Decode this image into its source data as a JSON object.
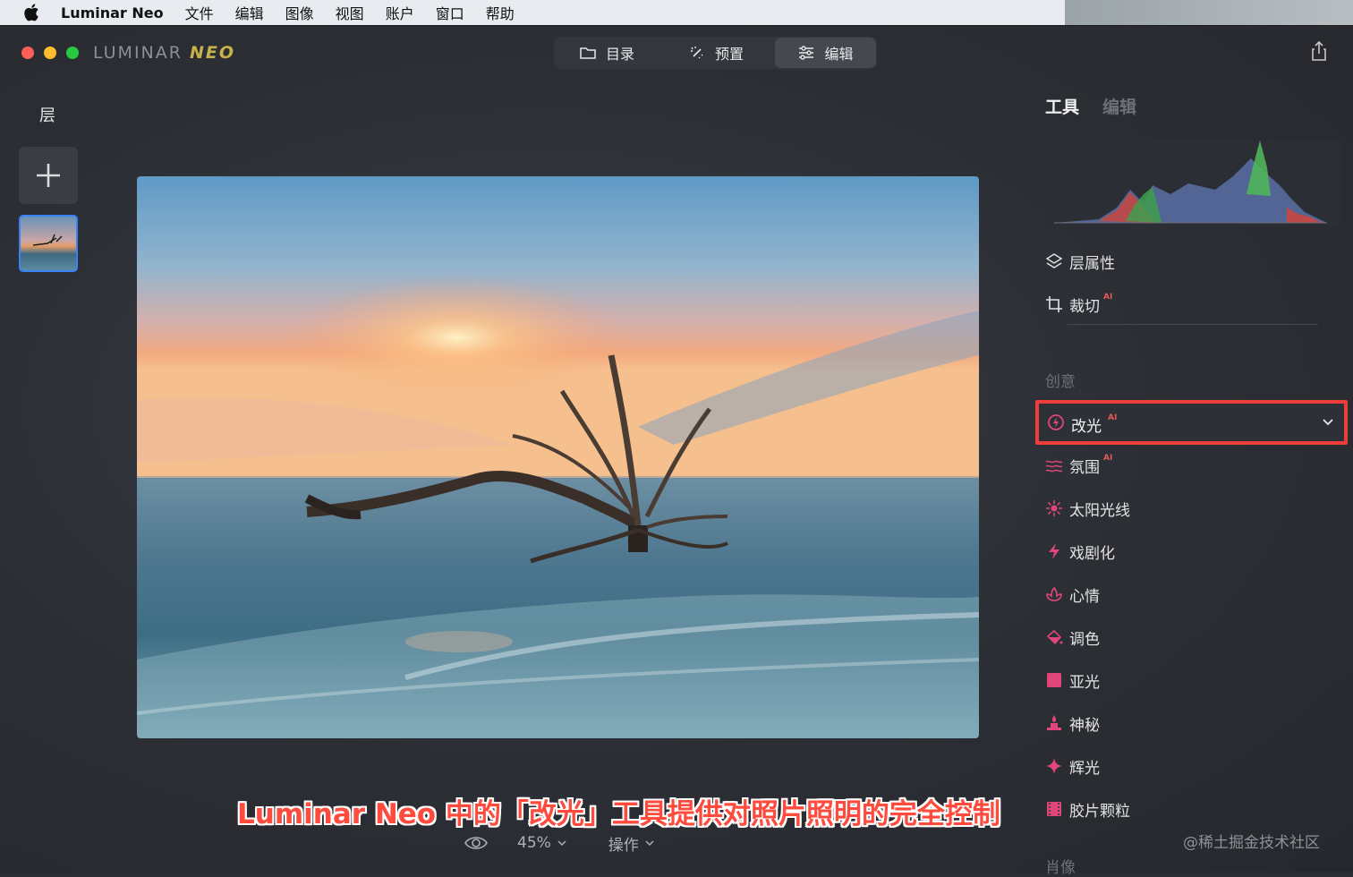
{
  "menubar": {
    "app_name": "Luminar Neo",
    "items": [
      "文件",
      "编辑",
      "图像",
      "视图",
      "账户",
      "窗口",
      "帮助"
    ]
  },
  "window": {
    "logo_left": "LUMINAR",
    "logo_right": "NEO"
  },
  "topnav": {
    "catalog": "目录",
    "presets": "预置",
    "edit": "编辑",
    "active": "编辑"
  },
  "layers": {
    "title": "层"
  },
  "right_panel": {
    "tabs": {
      "tools": "工具",
      "edits": "编辑"
    },
    "essentials": [
      {
        "label": "层属性",
        "icon": "layers-icon",
        "ai": ""
      },
      {
        "label": "裁切",
        "icon": "crop-icon",
        "ai": "AI"
      }
    ],
    "sections": {
      "creative": "创意",
      "portrait": "肖像"
    },
    "relight": {
      "label": "改光",
      "ai": "AI",
      "icon": "relight-icon",
      "expanded": false
    },
    "creative_tools": [
      {
        "label": "氛围",
        "icon": "atmosphere-icon",
        "ai": "AI"
      },
      {
        "label": "太阳光线",
        "icon": "sunrays-icon",
        "ai": ""
      },
      {
        "label": "戏剧化",
        "icon": "dramatic-icon",
        "ai": ""
      },
      {
        "label": "心情",
        "icon": "mood-icon",
        "ai": ""
      },
      {
        "label": "调色",
        "icon": "toning-icon",
        "ai": ""
      },
      {
        "label": "亚光",
        "icon": "matte-icon",
        "ai": ""
      },
      {
        "label": "神秘",
        "icon": "mystical-icon",
        "ai": ""
      },
      {
        "label": "辉光",
        "icon": "glow-icon",
        "ai": ""
      },
      {
        "label": "胶片颗粒",
        "icon": "film-grain-icon",
        "ai": ""
      }
    ],
    "accent_color": "#e0467a",
    "highlight_color": "#ef3e3a"
  },
  "bottom_bar": {
    "zoom": "45%",
    "actions": "操作"
  },
  "caption": "Luminar Neo 中的「改光」工具提供对照片照明的完全控制",
  "watermark": "@稀土掘金技术社区"
}
